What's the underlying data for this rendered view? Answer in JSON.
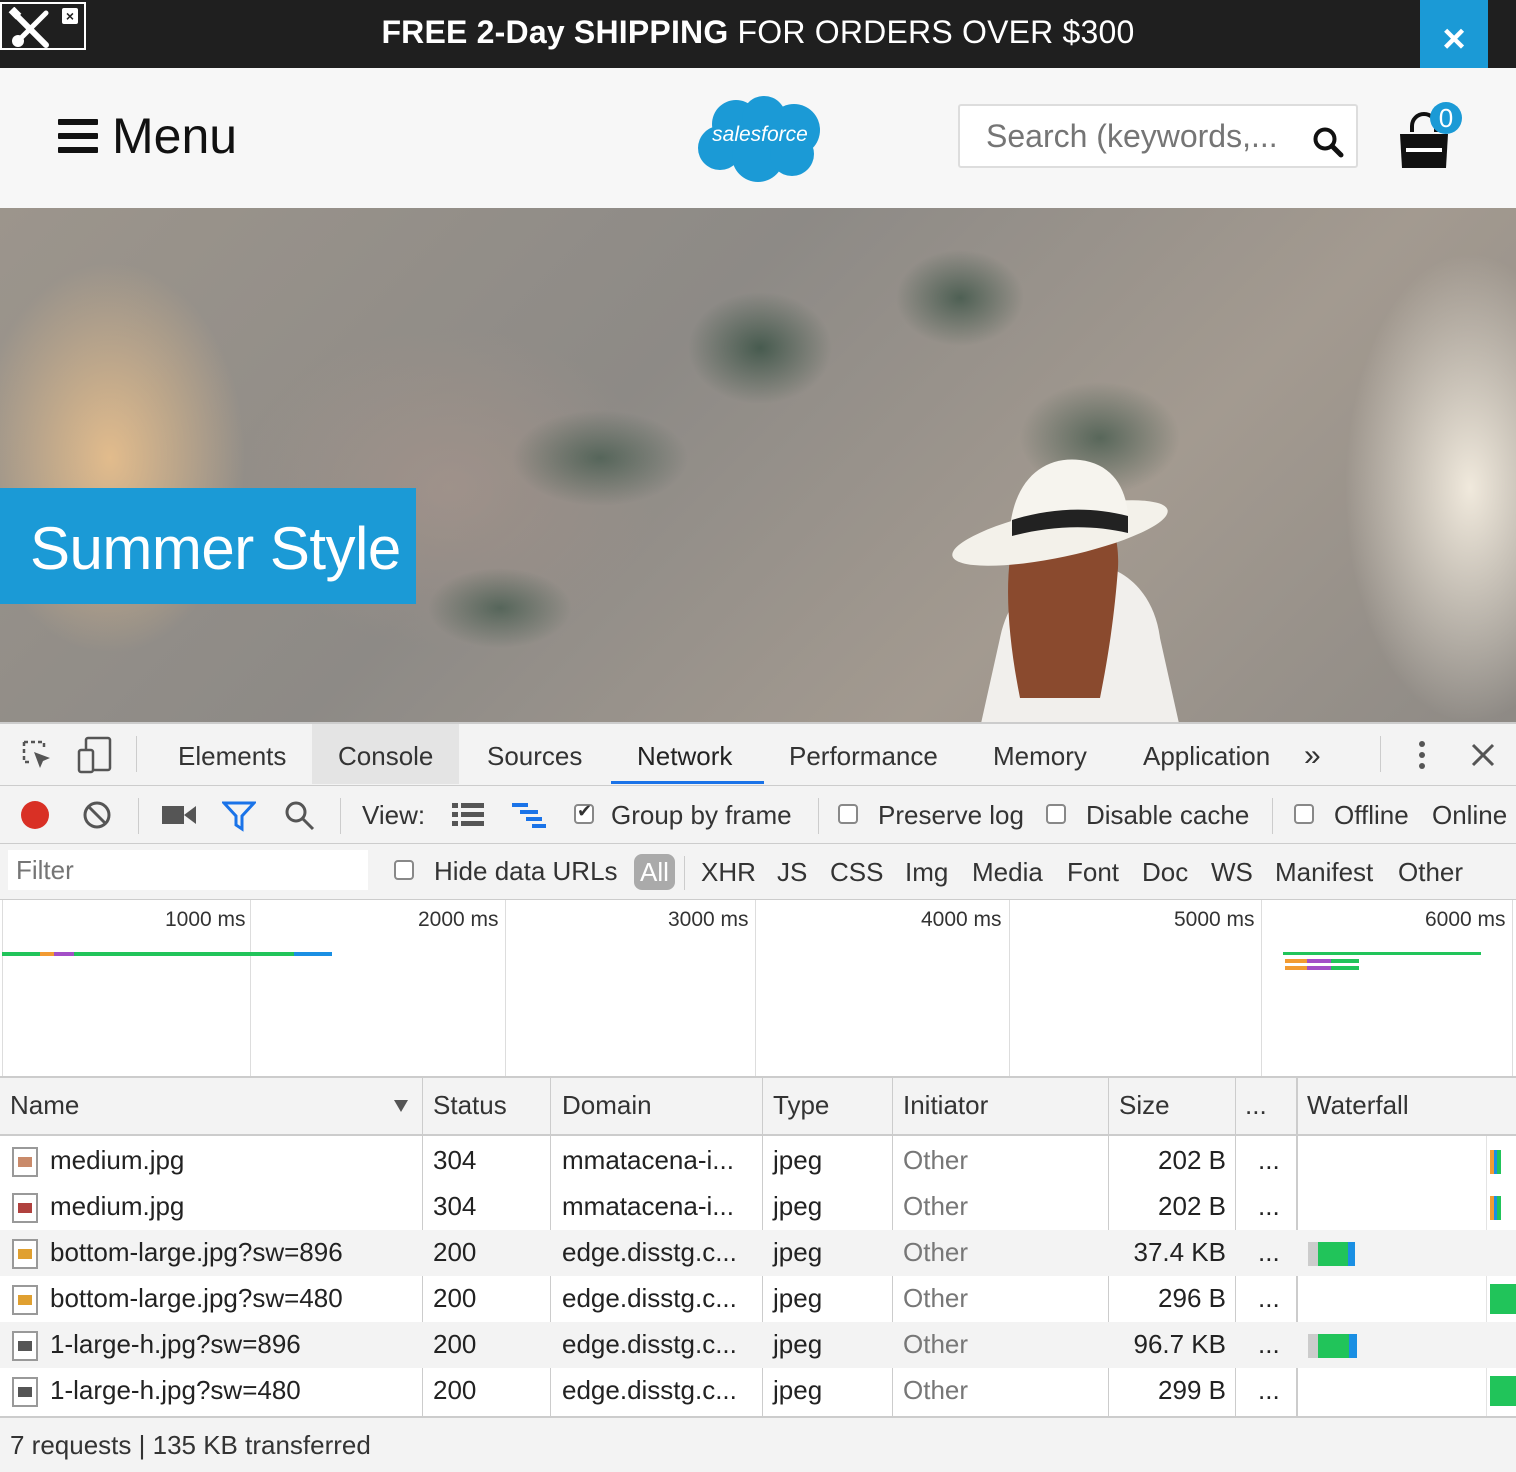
{
  "promo": {
    "bold_text": "FREE 2-Day SHIPPING",
    "text": " FOR ORDERS OVER $300",
    "close_label": "×"
  },
  "header": {
    "menu_label": "Menu",
    "logo_text": "salesforce",
    "search_placeholder": "Search (keywords,...",
    "cart_count": "0"
  },
  "hero": {
    "title": "Summer Style"
  },
  "devtools": {
    "tabs": [
      "Elements",
      "Console",
      "Sources",
      "Network",
      "Performance",
      "Memory",
      "Application"
    ],
    "active_tab": "Network",
    "more_tabs_label": "»",
    "toolbar": {
      "view_label": "View:",
      "group_by_frame": "Group by frame",
      "group_by_frame_checked": true,
      "preserve_log": "Preserve log",
      "disable_cache": "Disable cache",
      "offline": "Offline",
      "throttle": "Online"
    },
    "filter": {
      "placeholder": "Filter",
      "hide_data_urls": "Hide data URLs",
      "types": [
        "All",
        "XHR",
        "JS",
        "CSS",
        "Img",
        "Media",
        "Font",
        "Doc",
        "WS",
        "Manifest",
        "Other"
      ],
      "active_type": "All"
    },
    "overview": {
      "ticks": [
        "1000 ms",
        "2000 ms",
        "3000 ms",
        "4000 ms",
        "5000 ms",
        "6000 ms"
      ]
    },
    "table": {
      "columns": [
        "Name",
        "Status",
        "Domain",
        "Type",
        "Initiator",
        "Size",
        "...",
        "Waterfall"
      ],
      "rows": [
        {
          "name": "medium.jpg",
          "status": "304",
          "domain": "mmatacena-i...",
          "type": "jpeg",
          "initiator": "Other",
          "size": "202 B",
          "more": "..."
        },
        {
          "name": "medium.jpg",
          "status": "304",
          "domain": "mmatacena-i...",
          "type": "jpeg",
          "initiator": "Other",
          "size": "202 B",
          "more": "..."
        },
        {
          "name": "bottom-large.jpg?sw=896",
          "status": "200",
          "domain": "edge.disstg.c...",
          "type": "jpeg",
          "initiator": "Other",
          "size": "37.4 KB",
          "more": "..."
        },
        {
          "name": "bottom-large.jpg?sw=480",
          "status": "200",
          "domain": "edge.disstg.c...",
          "type": "jpeg",
          "initiator": "Other",
          "size": "296 B",
          "more": "..."
        },
        {
          "name": "1-large-h.jpg?sw=896",
          "status": "200",
          "domain": "edge.disstg.c...",
          "type": "jpeg",
          "initiator": "Other",
          "size": "96.7 KB",
          "more": "..."
        },
        {
          "name": "1-large-h.jpg?sw=480",
          "status": "200",
          "domain": "edge.disstg.c...",
          "type": "jpeg",
          "initiator": "Other",
          "size": "299 B",
          "more": "..."
        }
      ]
    },
    "summary": "7 requests | 135 KB transferred"
  },
  "colors": {
    "brand_blue": "#1b9ad6",
    "record_red": "#d93025",
    "waterfall_green": "#21c45a",
    "waterfall_blue": "#1a8fe3"
  }
}
